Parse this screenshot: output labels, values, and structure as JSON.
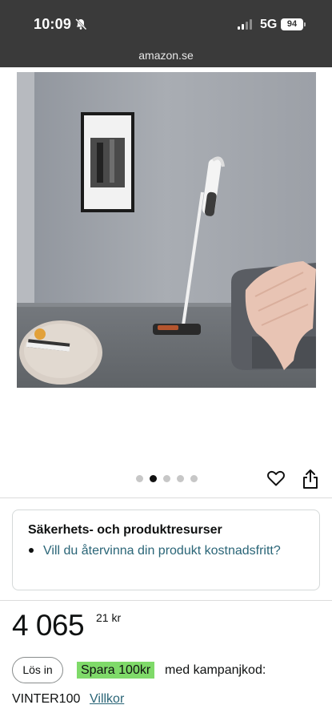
{
  "status_bar": {
    "time": "10:09",
    "network": "5G",
    "battery": "94"
  },
  "browser": {
    "url": "amazon.se"
  },
  "gallery": {
    "image_count": 5,
    "active_index": 1
  },
  "actions": {
    "favorite_icon": "heart-icon",
    "share_icon": "share-icon"
  },
  "safety_card": {
    "title": "Säkerhets- och produktresurser",
    "link": "Vill du återvinna din produkt kostnadsfritt?"
  },
  "price": {
    "whole": "4 065",
    "fraction": "21",
    "currency": "kr"
  },
  "coupon": {
    "redeem_button": "Lös in",
    "badge": "Spara 100kr",
    "text": "med kampanjkod:",
    "code": "VINTER100",
    "terms_link": "Villkor"
  },
  "colors": {
    "status_bar": "#3a3a3a",
    "link": "#2a6577",
    "save_badge": "#7fda69"
  }
}
